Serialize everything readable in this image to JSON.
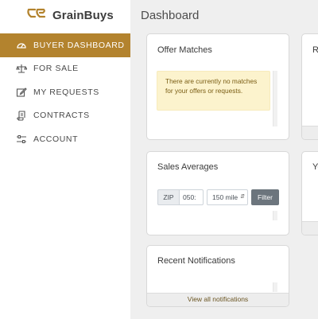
{
  "brand": {
    "name": "GrainBuys",
    "accent": "#b3832e"
  },
  "sidebar": {
    "items": [
      {
        "label": "BUYER DASHBOARD",
        "icon": "gauge-icon",
        "active": true
      },
      {
        "label": "FOR SALE",
        "icon": "scale-icon",
        "active": false
      },
      {
        "label": "MY REQUESTS",
        "icon": "edit-icon",
        "active": false
      },
      {
        "label": "CONTRACTS",
        "icon": "scroll-icon",
        "active": false
      },
      {
        "label": "ACCOUNT",
        "icon": "sliders-icon",
        "active": false
      }
    ]
  },
  "main": {
    "title": "Dashboard",
    "offer_matches": {
      "title": "Offer Matches",
      "alert": "There are currently no matches for your offers or requests."
    },
    "sales_averages": {
      "title": "Sales Averages",
      "zip_label": "ZIP",
      "zip_value": "050:",
      "radius_value": "150 mile",
      "filter_label": "Filter"
    },
    "recent_notifications": {
      "title": "Recent Notifications",
      "footer_link": "View all notifications"
    },
    "right_cards": [
      {
        "title": "R"
      },
      {
        "title": "Yo"
      }
    ]
  }
}
